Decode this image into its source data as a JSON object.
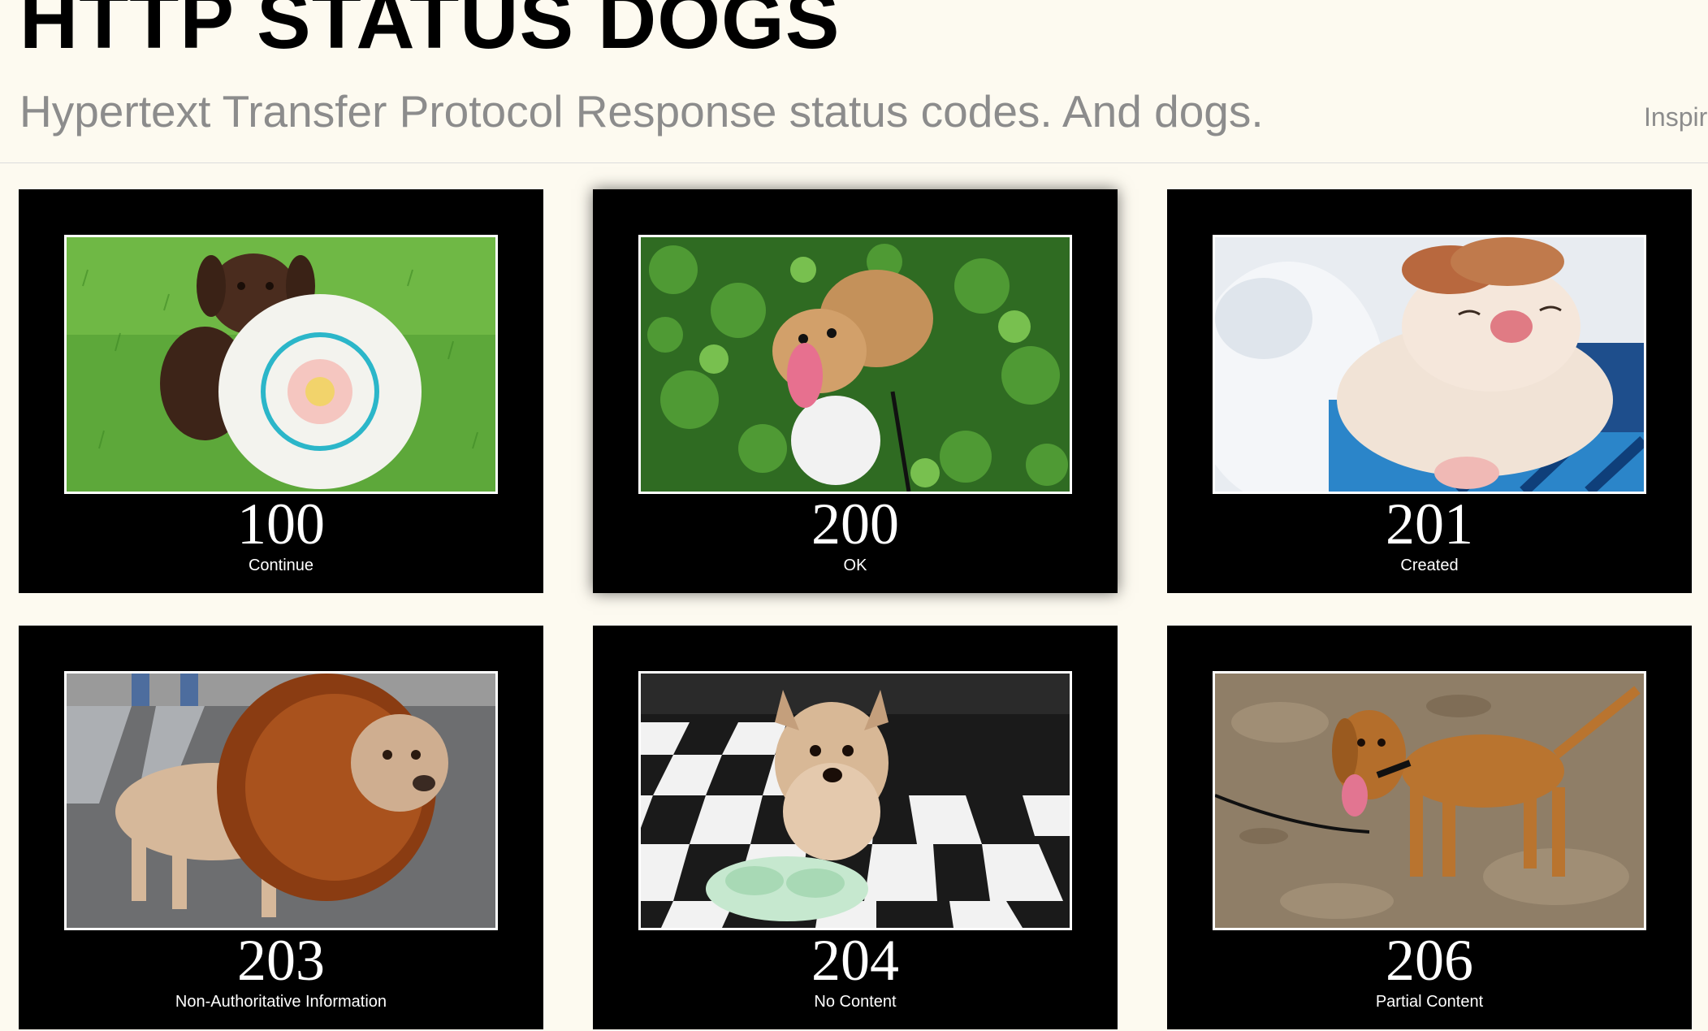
{
  "header": {
    "title": "HTTP STATUS DOGS",
    "tagline": "Hypertext Transfer Protocol Response status codes. And dogs.",
    "inspired_link": "Inspir"
  },
  "cards": [
    {
      "code": "100",
      "label": "Continue",
      "photo": "chocolate-lab-puppy-with-frisbee-on-grass"
    },
    {
      "code": "200",
      "label": "OK",
      "photo": "happy-dog-in-ivy-leaves"
    },
    {
      "code": "201",
      "label": "Created",
      "photo": "sleeping-white-puppy-on-blanket"
    },
    {
      "code": "203",
      "label": "Non-Authoritative Information",
      "photo": "dog-in-lion-mane-costume"
    },
    {
      "code": "204",
      "label": "No Content",
      "photo": "dog-with-empty-bowl-on-checkered-floor"
    },
    {
      "code": "206",
      "label": "Partial Content",
      "photo": "brown-hound-on-leash-on-dirt"
    }
  ],
  "colors": {
    "background": "#fdfaf0",
    "card": "#000000",
    "tagline": "#8c8c8c"
  }
}
